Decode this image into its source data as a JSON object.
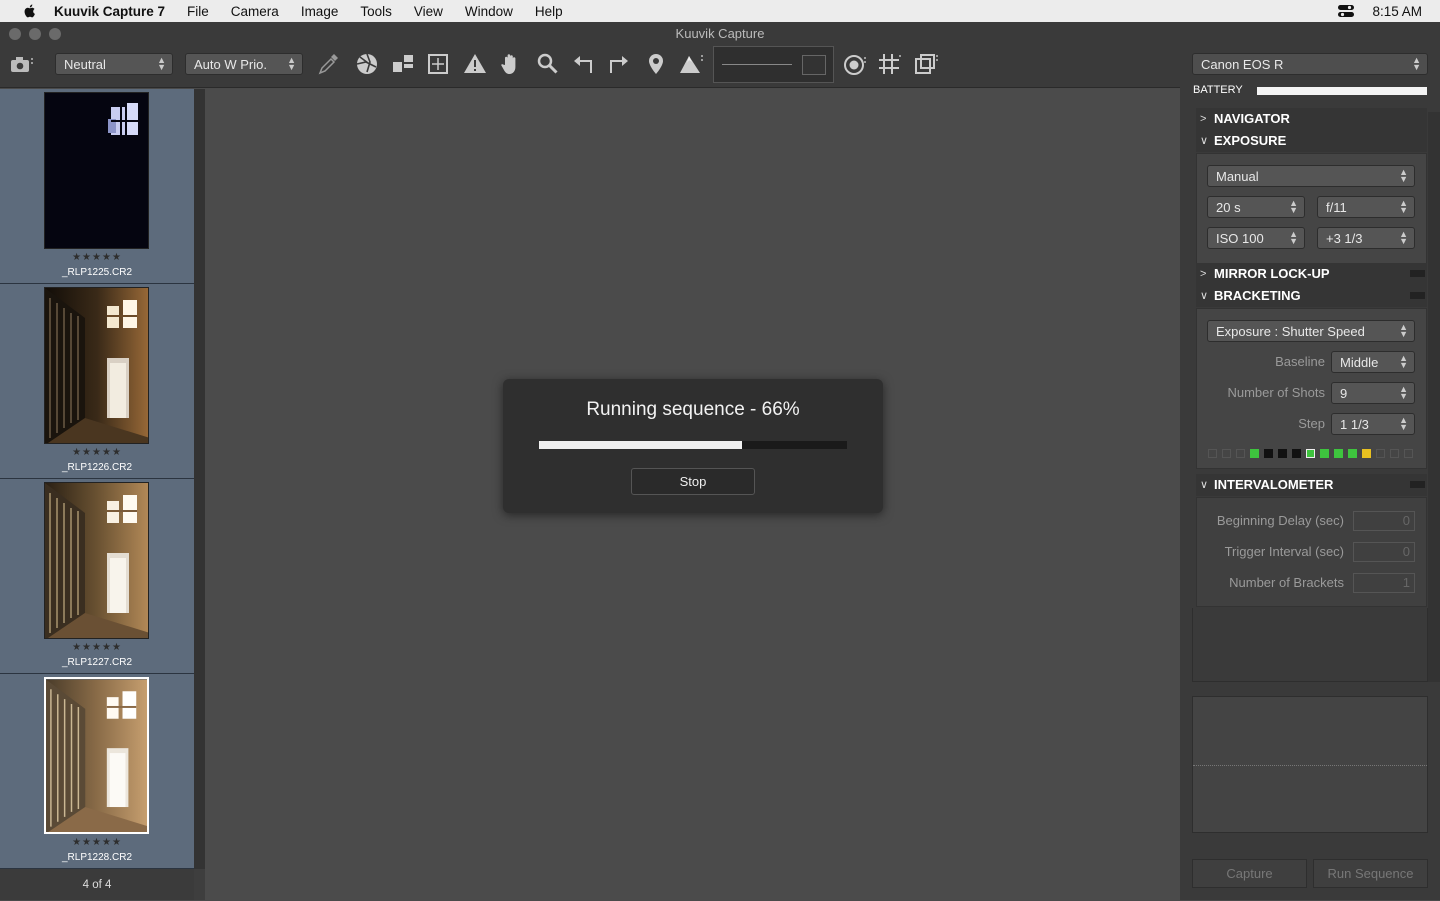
{
  "menubar": {
    "app_name": "Kuuvik Capture 7",
    "items": [
      "File",
      "Camera",
      "Image",
      "Tools",
      "View",
      "Window",
      "Help"
    ],
    "clock": "8:15 AM"
  },
  "window": {
    "title": "Kuuvik Capture"
  },
  "toolbar": {
    "picture_style": "Neutral",
    "white_balance": "Auto W Prio."
  },
  "filmstrip": {
    "items": [
      {
        "filename": "_RLP1225.CR2",
        "rating_stars": "★★★★★",
        "selected": false
      },
      {
        "filename": "_RLP1226.CR2",
        "rating_stars": "★★★★★",
        "selected": false
      },
      {
        "filename": "_RLP1227.CR2",
        "rating_stars": "★★★★★",
        "selected": false
      },
      {
        "filename": "_RLP1228.CR2",
        "rating_stars": "★★★★★",
        "selected": true
      }
    ],
    "count": "4 of 4"
  },
  "dialog": {
    "message": "Running sequence - 66%",
    "progress": 0.66,
    "stop_label": "Stop"
  },
  "panel": {
    "camera": "Canon EOS R",
    "battery_label": "BATTERY",
    "battery_level": 1.0,
    "sections": {
      "navigator": "NAVIGATOR",
      "exposure": "EXPOSURE",
      "mirror": "MIRROR LOCK-UP",
      "bracketing": "BRACKETING",
      "intervalometer": "INTERVALOMETER"
    },
    "exposure": {
      "mode": "Manual",
      "shutter": "20 s",
      "aperture": "f/11",
      "iso": "ISO 100",
      "compensation": "+3 1/3"
    },
    "bracketing": {
      "type": "Exposure : Shutter Speed",
      "baseline_label": "Baseline",
      "baseline": "Middle",
      "shots_label": "Number of Shots",
      "shots": "9",
      "step_label": "Step",
      "step": "1 1/3"
    },
    "intervalometer": {
      "delay_label": "Beginning Delay (sec)",
      "delay": "0",
      "interval_label": "Trigger Interval (sec)",
      "interval": "0",
      "brackets_label": "Number of Brackets",
      "brackets": "1"
    },
    "capture_label": "Capture",
    "run_label": "Run Sequence"
  },
  "colors": {
    "bracket_done": "#3ec43e",
    "bracket_current": "#e8c020",
    "bracket_dark": "#111111"
  }
}
